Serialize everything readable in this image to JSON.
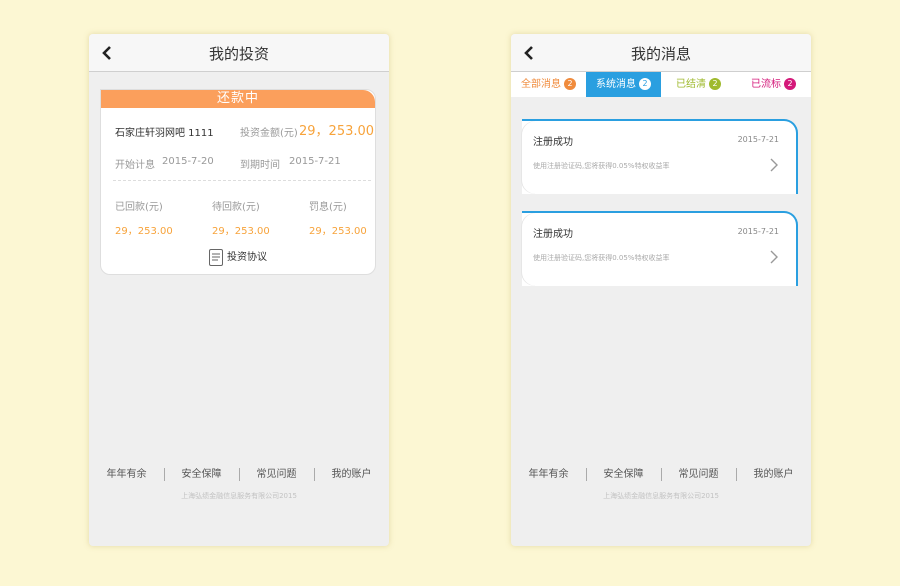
{
  "left": {
    "title": "我的投资",
    "status": "还款中",
    "project_name": "石家庄轩羽网吧 1111",
    "amount_label": "投资金额(元)",
    "amount_value": "29，253.00",
    "start_label": "开始计息",
    "start_value": "2015-7-20",
    "end_label": "到期时间",
    "end_value": "2015-7-21",
    "columns": [
      {
        "label": "已回款(元)",
        "value": "29，253.00"
      },
      {
        "label": "待回款(元)",
        "value": "29，253.00"
      },
      {
        "label": "罚息(元)",
        "value": "29，253.00"
      }
    ],
    "agreement": "投资协议"
  },
  "right": {
    "title": "我的消息",
    "tabs": [
      {
        "label": "全部消息",
        "badge": "2",
        "color": "#f08b3c"
      },
      {
        "label": "系统消息",
        "badge": "2",
        "color": "#ffffff"
      },
      {
        "label": "已结清",
        "badge": "2",
        "color": "#9fba2e"
      },
      {
        "label": "已流标",
        "badge": "2",
        "color": "#d4197a"
      }
    ],
    "messages": [
      {
        "title": "注册成功",
        "date": "2015-7-21",
        "body": "使用注册验证码,您将获得0.05%特权收益率"
      },
      {
        "title": "注册成功",
        "date": "2015-7-21",
        "body": "使用注册验证码,您将获得0.05%特权收益率"
      }
    ]
  },
  "footer": {
    "links": [
      "年年有余",
      "安全保障",
      "常见问题",
      "我的账户"
    ],
    "copyright": "上海弘绩金融信息服务有限公司2015"
  },
  "colors": {
    "accent_orange": "#fb9f5c",
    "accent_blue": "#2a9fe0",
    "value_orange": "#f7a33b"
  }
}
